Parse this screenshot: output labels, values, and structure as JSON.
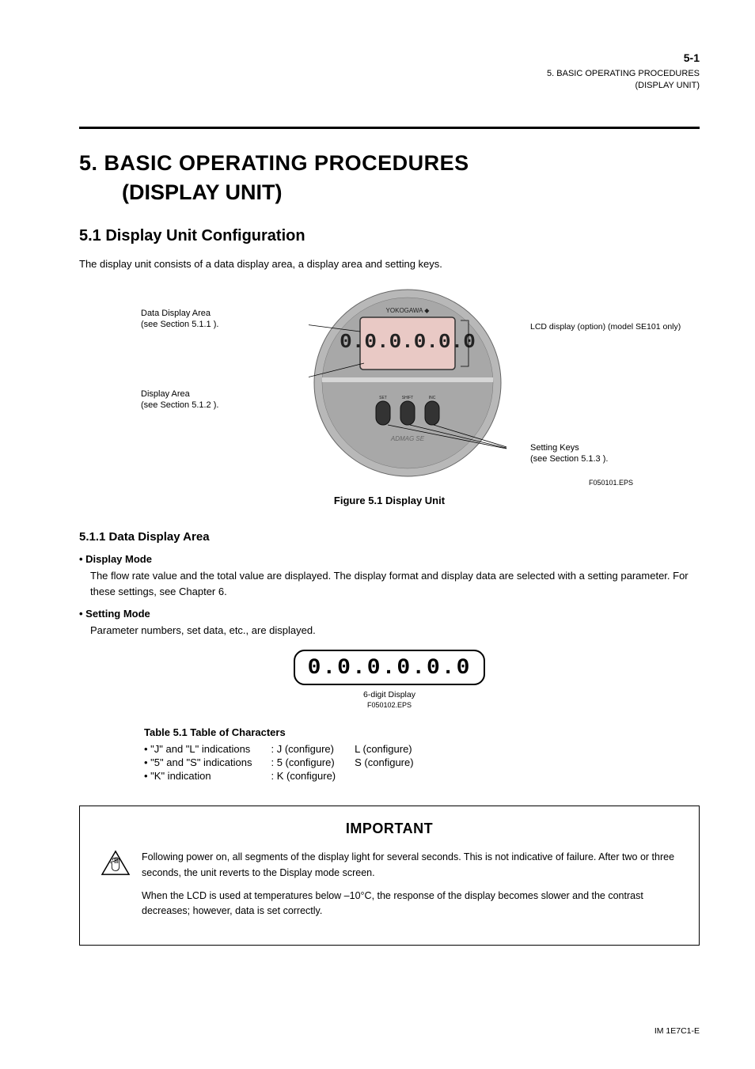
{
  "header": {
    "page_num": "5-1",
    "manual_id": "IM  1E7C1-E",
    "section_ref": "5. BASIC OPERATING  PROCEDURES\n(DISPLAY UNIT)"
  },
  "chapter": {
    "number": "5.",
    "title": "BASIC OPERATING PROCEDURES",
    "subtitle": "(DISPLAY UNIT)"
  },
  "section_5_1": {
    "heading": "5.1 Display Unit Configuration",
    "para": "The display unit consists of a data display area, a display area and setting keys."
  },
  "figure_5_1": {
    "caption": "Figure 5.1 Display Unit",
    "callout_data_display": "Data Display Area",
    "callout_data_display_sub": "(see Section 5.1.1 ).",
    "callout_display_area": "Display Area",
    "callout_display_area_sub": "(see Section 5.1.2 ).",
    "callout_setkeys": "Setting Keys",
    "callout_setkeys_sub": "(see Section 5.1.3 ).",
    "callout_lcd_note": "LCD display (option) (model SE101 only)",
    "device_brand": "YOKOGAWA",
    "device_model": "ADMAG SE",
    "device_display_value": "0.0.0.0.0.0",
    "btn_set": "SET",
    "btn_shift": "SHIFT",
    "btn_inc": "INC",
    "fig_code": "F050101.EPS"
  },
  "subsection_5_1_1": {
    "heading": "5.1.1 Data Display Area",
    "bullet1_title": "• Display Mode",
    "bullet1_desc": "The flow rate value and the total value are displayed. The display format and display data are selected with a setting parameter. For these settings, see Chapter 6.",
    "bullet2_title": "• Setting Mode",
    "bullet2_desc": "Parameter numbers, set data, etc., are displayed.",
    "six_digit_value": "0.0.0.0.0.0",
    "six_digit_caption": "6-digit Display",
    "six_digit_figcode": "F050102.EPS"
  },
  "table_5_1": {
    "title": "Table 5.1 Table of Characters",
    "rows": [
      [
        "•  \"J\" and \"L\" indications",
        ": J (configure)",
        "L (configure)"
      ],
      [
        "•  \"5\" and \"S\" indications",
        ": 5 (configure)",
        "S (configure)"
      ],
      [
        "•  \"K\" indication",
        ": K (configure)",
        ""
      ]
    ]
  },
  "important": {
    "title": "IMPORTANT",
    "p1": "Following power on, all segments of the display light for several seconds. This is not indicative of failure. After two or three seconds, the unit reverts to the Display mode screen.",
    "p2": "When the LCD is used at temperatures below –10°C, the response of the display becomes slower and the contrast decreases; however, data is set correctly."
  },
  "footer": {
    "manual_id": "IM  1E7C1-E"
  }
}
